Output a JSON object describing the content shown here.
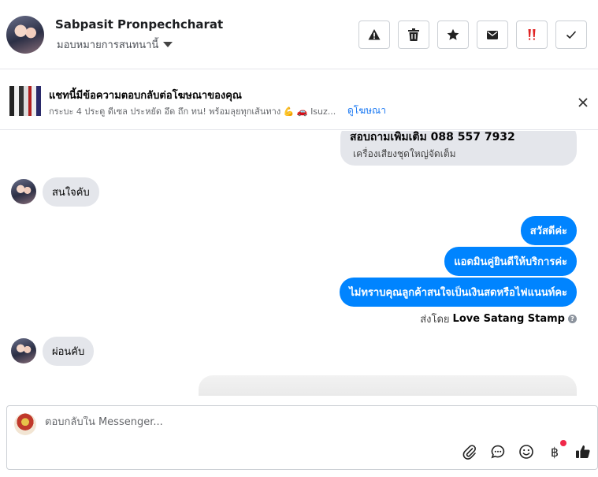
{
  "header": {
    "contact_name": "Sabpasit Pronpechcharat",
    "assign_label": "มอบหมายการสนทนานี้",
    "actions": [
      {
        "icon": "warning-icon"
      },
      {
        "icon": "trash-icon"
      },
      {
        "icon": "star-icon"
      },
      {
        "icon": "envelope-icon"
      },
      {
        "icon": "double-exclamation-icon"
      },
      {
        "icon": "checkmark-icon"
      }
    ]
  },
  "ad_banner": {
    "title": "แชทนี้มีข้อความตอบกลับต่อโฆษณาของคุณ",
    "subtitle": "กระบะ 4 ประตู ดีเซล ประหยัด อึด ถึก ทน! พร้อมลุยทุกเส้นทาง 💪 🚗 Isuz...",
    "link": "ดูโฆษณา"
  },
  "messages": {
    "inquiry_line": "สอบถามเพิ่มเติม 088 557 7932",
    "inquiry_sub": "เครื่องเสียงชุดใหญ่จัดเต็ม",
    "customer_1": "สนใจคับ",
    "agent_1": "สวัสดีค่ะ",
    "agent_2": "แอดมินคู่ยินดีให้บริการค่ะ",
    "agent_3": "ไม่ทราบคุณลูกค้าสนใจเป็นเงินสดหรือไฟแนนท์คะ",
    "sent_by_prefix": "ส่งโดย",
    "sent_by_name": "Love Satang Stamp",
    "help": "?",
    "customer_2": "ผ่อนคับ"
  },
  "composer": {
    "placeholder": "ตอบกลับใน Messenger...",
    "baht_symbol": "฿"
  },
  "colors": {
    "outgoing": "#0084ff",
    "incoming": "#e4e6eb",
    "link": "#1877f2",
    "notification_dot": "#f02849"
  }
}
